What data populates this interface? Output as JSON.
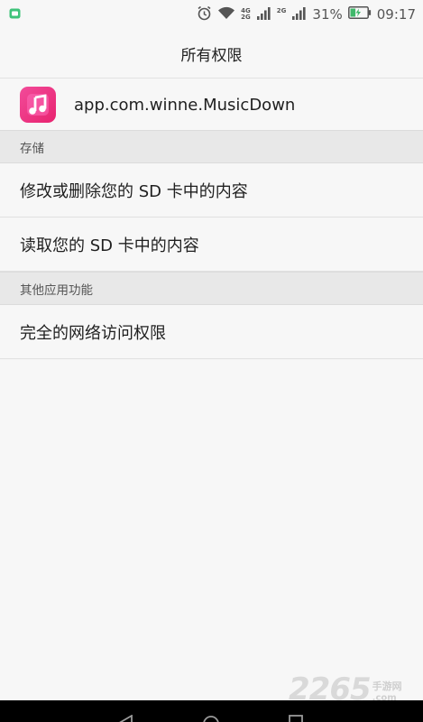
{
  "status_bar": {
    "net_top": "4G",
    "net_bottom": "2G",
    "net_right": "2G",
    "battery_percent": "31%",
    "time": "09:17",
    "battery_level": 0.31
  },
  "header": {
    "title": "所有权限"
  },
  "app": {
    "package_name": "app.com.winne.MusicDown",
    "icon": "music-note-icon"
  },
  "sections": [
    {
      "title": "存储",
      "items": [
        {
          "label": "修改或删除您的 SD 卡中的内容"
        },
        {
          "label": "读取您的 SD 卡中的内容"
        }
      ]
    },
    {
      "title": "其他应用功能",
      "items": [
        {
          "label": "完全的网络访问权限"
        }
      ]
    }
  ],
  "watermark": {
    "number": "2265",
    "site_cn": "手游网",
    "site_en": ".com"
  },
  "colors": {
    "accent": "#e8236f",
    "background": "#f7f7f7",
    "section_bg": "#e8e8e8"
  }
}
